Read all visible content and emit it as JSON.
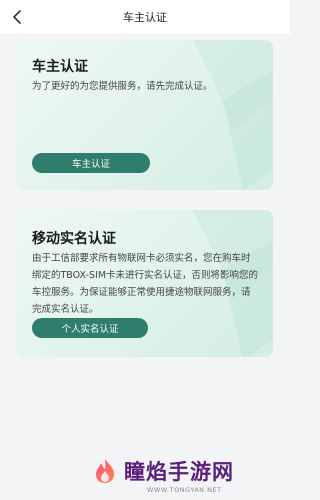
{
  "nav": {
    "back_icon": "chevron-left-icon",
    "title": "车主认证"
  },
  "owner_card": {
    "title": "车主认证",
    "description": "为了更好的为您提供服务，请先完成认证。",
    "button_label": "车主认证"
  },
  "realname_card": {
    "title": "移动实名认证",
    "description": "由于工信部要求所有物联网卡必须实名，您在购车时绑定的TBOX-SIM卡未进行实名认证，否则将影响您的车控服务。为保证能够正常使用捷途物联网服务，请完成实名认证。",
    "button_label": "个人实名认证"
  },
  "watermark": {
    "logo_icon": "flame-logo-icon",
    "text": "瞳焰手游网",
    "url": "WWW.TONGYAN.NET"
  },
  "colors": {
    "accent": "#2e7d6d",
    "card_bg": "#e3f3ee",
    "page_bg": "#f3f4f5"
  }
}
